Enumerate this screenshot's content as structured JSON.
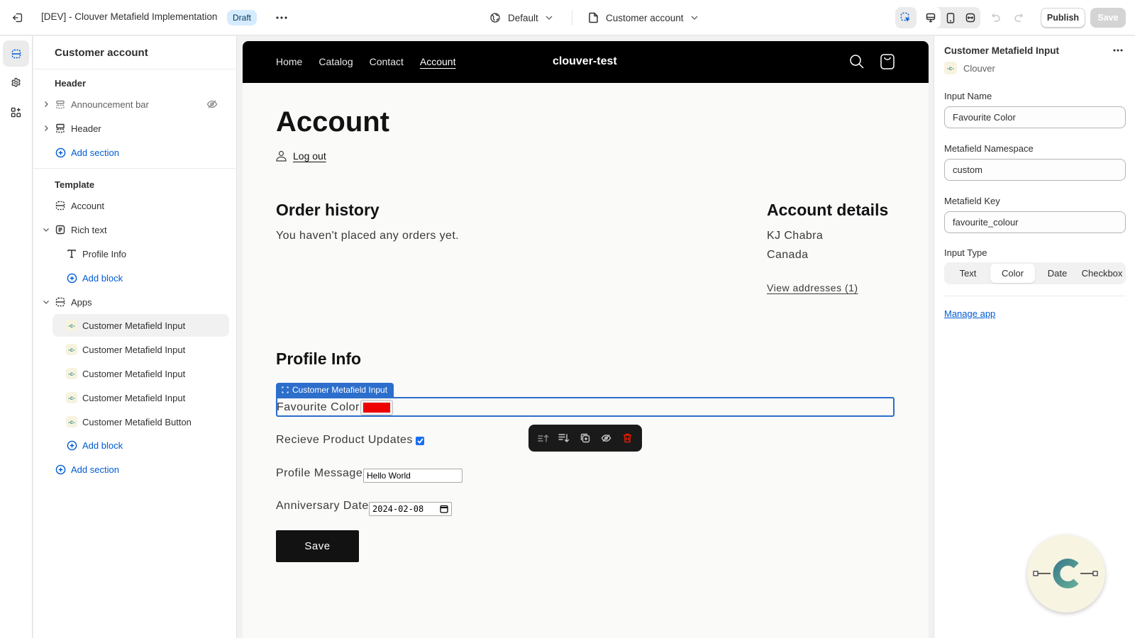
{
  "topbar": {
    "title": "[DEV] - Clouver Metafield Implementation",
    "status_badge": "Draft",
    "theme_selector": "Default",
    "page_selector": "Customer account",
    "publish_label": "Publish",
    "save_label": "Save"
  },
  "rail": {
    "items": [
      "sections-icon",
      "settings-icon",
      "apps-icon"
    ],
    "active": "sections-icon"
  },
  "sidebar": {
    "title": "Customer account",
    "header_group": {
      "label": "Header",
      "items": [
        {
          "label": "Announcement bar",
          "hidden": true
        },
        {
          "label": "Header",
          "hidden": false
        }
      ],
      "add_label": "Add section"
    },
    "template_group": {
      "label": "Template",
      "sections": [
        {
          "label": "Account"
        },
        {
          "label": "Rich text",
          "blocks": [
            {
              "label": "Profile Info"
            }
          ],
          "add_label": "Add block"
        },
        {
          "label": "Apps",
          "blocks": [
            {
              "label": "Customer Metafield Input",
              "selected": true
            },
            {
              "label": "Customer Metafield Input"
            },
            {
              "label": "Customer Metafield Input"
            },
            {
              "label": "Customer Metafield Input"
            },
            {
              "label": "Customer Metafield Button"
            }
          ],
          "add_label": "Add block"
        }
      ],
      "add_label": "Add section"
    }
  },
  "preview": {
    "nav": [
      "Home",
      "Catalog",
      "Contact",
      "Account"
    ],
    "active_nav": "Account",
    "store_name": "clouver-test",
    "page_title": "Account",
    "logout_label": "Log out",
    "order_history": {
      "title": "Order history",
      "empty_text": "You haven't placed any orders yet."
    },
    "account_details": {
      "title": "Account details",
      "name": "KJ Chabra",
      "country": "Canada",
      "addresses_link": "View addresses (1)"
    },
    "profile": {
      "title": "Profile Info",
      "block_tag": "Customer Metafield Input",
      "favourite_color_label": "Favourite Color",
      "favourite_color_value": "#ee0000",
      "updates_label": "Recieve Product Updates",
      "updates_checked": true,
      "message_label": "Profile Message",
      "message_value": "Hello World",
      "date_label": "Anniversary Date",
      "date_value": "2024-02-08",
      "save_label": "Save"
    },
    "floating_toolbar": [
      "move-up-icon",
      "move-down-icon",
      "duplicate-icon",
      "hide-icon",
      "delete-icon"
    ]
  },
  "right_panel": {
    "title": "Customer Metafield Input",
    "app_name": "Clouver",
    "fields": [
      {
        "label": "Input Name",
        "value": "Favourite Color"
      },
      {
        "label": "Metafield Namespace",
        "value": "custom"
      },
      {
        "label": "Metafield Key",
        "value": "favourite_colour"
      }
    ],
    "input_type": {
      "label": "Input Type",
      "options": [
        "Text",
        "Color",
        "Date",
        "Checkbox"
      ],
      "selected": "Color"
    },
    "manage_link": "Manage app"
  },
  "colors": {
    "accent_blue": "#005bd3",
    "selection_blue": "#2c6ecb",
    "draft_badge_bg": "#d5ebff",
    "app_teal": "#3d8a86"
  }
}
